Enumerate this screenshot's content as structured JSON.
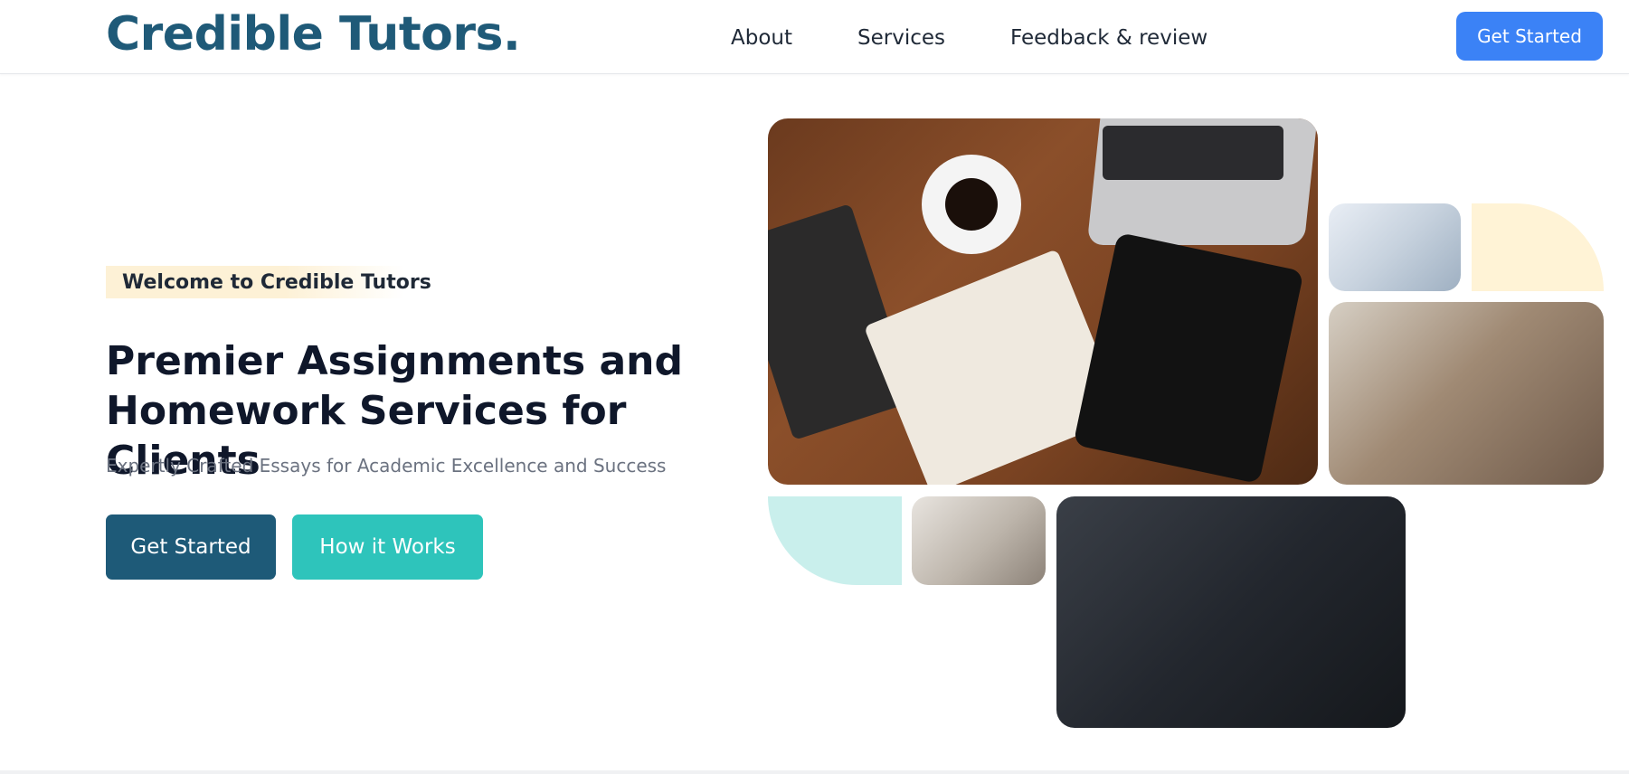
{
  "nav": {
    "logo": "Credible Tutors.",
    "links": [
      "About",
      "Services",
      "Feedback & review"
    ],
    "cta": "Get Started"
  },
  "hero": {
    "badge": "Welcome to Credible Tutors",
    "title_line1": "Premier Assignments and",
    "title_line2": "Homework Services for Clients",
    "subtitle": "Expertly Crafted Essays for Academic Excellence and Success",
    "primary_button": "Get Started",
    "secondary_button": "How it Works"
  },
  "colors": {
    "brand": "#1f5a78",
    "nav_cta": "#3b82f6",
    "primary_button": "#1e5a78",
    "secondary_button": "#2ec4bb",
    "badge_bg": "#fdf1d6",
    "accent_yellow": "#fff3d6",
    "accent_teal": "#c9efec"
  }
}
